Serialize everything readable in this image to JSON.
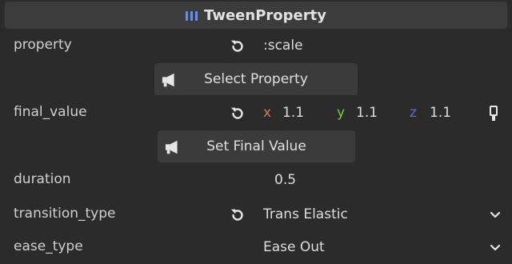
{
  "header": {
    "title": "TweenProperty",
    "icon": "list-bars-icon"
  },
  "properties": {
    "property": {
      "label": "property",
      "value": ":scale"
    },
    "select_property_button": "Select Property",
    "final_value": {
      "label": "final_value",
      "x_label": "x",
      "x_value": "1.1",
      "y_label": "y",
      "y_value": "1.1",
      "z_label": "z",
      "z_value": "1.1"
    },
    "set_final_value_button": "Set Final Value",
    "duration": {
      "label": "duration",
      "value": "0.5"
    },
    "transition_type": {
      "label": "transition_type",
      "value": "Trans Elastic"
    },
    "ease_type": {
      "label": "ease_type",
      "value": "Ease Out"
    }
  },
  "colors": {
    "background": "#2b2b2b",
    "header_bg": "#3c3c3c",
    "axis_x": "#e0714d",
    "axis_y": "#6fcf4a",
    "axis_z": "#5a6fe0",
    "accent_icon": "#6e8fe0"
  }
}
